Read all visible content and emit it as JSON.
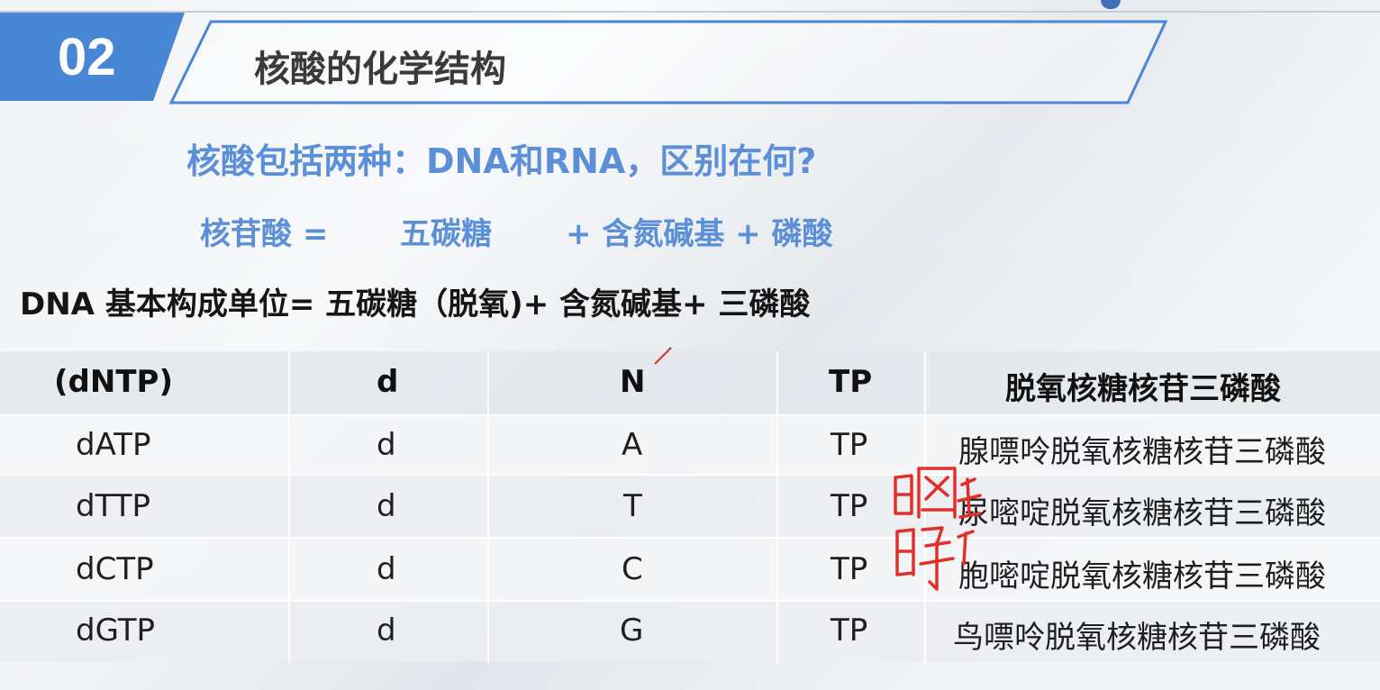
{
  "header": {
    "number": "02",
    "title": "核酸的化学结构"
  },
  "question": "核酸包括两种：DNA和RNA，区别在何?",
  "formula": {
    "lhs": "核苷酸 =",
    "sugar": "五碳糖",
    "rest": "+ 含氮碱基 + 磷酸"
  },
  "dna_unit": "DNA 基本构成单位= 五碳糖（脱氧)+ 含氮碱基+  三磷酸",
  "table": {
    "headers": [
      "(dNTP)",
      "d",
      "N",
      "TP",
      "脱氧核糖核苷三磷酸"
    ],
    "rows": [
      [
        "dATP",
        "d",
        "A",
        "TP",
        "腺嘌呤脱氧核糖核苷三磷酸"
      ],
      [
        "dTTP",
        "d",
        "T",
        "TP",
        "尿嘧啶脱氧核糖核苷三磷酸"
      ],
      [
        "dCTP",
        "d",
        "C",
        "TP",
        "胞嘧啶脱氧核糖核苷三磷酸"
      ],
      [
        "dGTP",
        "d",
        "G",
        "TP",
        "鸟嘌呤脱氧核糖核苷三磷酸"
      ]
    ]
  },
  "colors": {
    "accent_blue": "#4a86d6",
    "text_blue": "#5b8fd8",
    "annotation_red": "#e0302a"
  }
}
